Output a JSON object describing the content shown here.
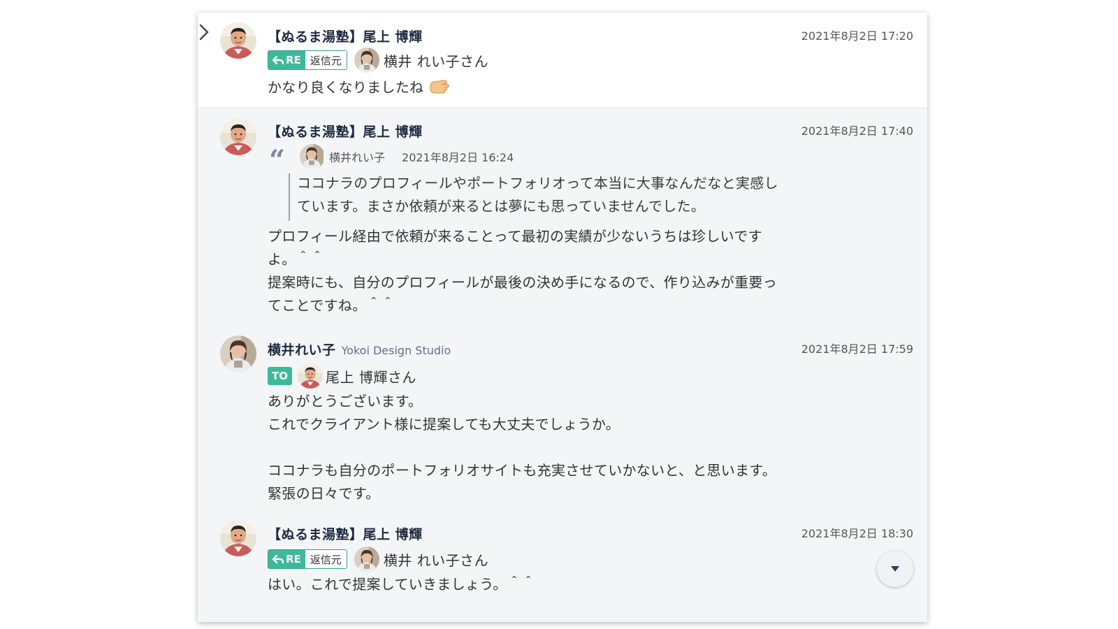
{
  "messages": [
    {
      "sender": "【ぬるま湯塾】尾上 博輝",
      "time": "2021年8月2日 17:20",
      "reply": {
        "badge": "RE",
        "source_label": "返信元",
        "target": "横井 れい子さん"
      },
      "body": [
        "かなり良くなりましたね"
      ]
    },
    {
      "sender": "【ぬるま湯塾】尾上 博輝",
      "time": "2021年8月2日 17:40",
      "quote": {
        "author": "横井れい子",
        "time": "2021年8月2日 16:24",
        "lines": [
          "ココナラのプロフィールやポートフォリオって本当に大事なんだなと実感し",
          "ています。まさか依頼が来るとは夢にも思っていませんでした。"
        ]
      },
      "body": [
        "プロフィール経由で依頼が来ることって最初の実績が少ないうちは珍しいです",
        "よ。＾＾",
        "提案時にも、自分のプロフィールが最後の決め手になるので、作り込みが重要っ",
        "てことですね。＾＾"
      ]
    },
    {
      "sender": "横井れい子",
      "org": "Yokoi Design Studio",
      "time": "2021年8月2日 17:59",
      "to": {
        "badge": "TO",
        "target": "尾上 博輝さん"
      },
      "body": [
        "ありがとうございます。",
        "これでクライアント様に提案しても大丈夫でしょうか。",
        "",
        "ココナラも自分のポートフォリオサイトも充実させていかないと、と思います。",
        "緊張の日々です。"
      ]
    },
    {
      "sender": "【ぬるま湯塾】尾上 博輝",
      "time": "2021年8月2日 18:30",
      "reply": {
        "badge": "RE",
        "source_label": "返信元",
        "target": "横井 れい子さん"
      },
      "body": [
        "はい。これで提案していきましょう。＾＾"
      ]
    }
  ],
  "icons": {
    "expand": "chevron-right-icon",
    "reply": "reply-arrow-icon",
    "quote": "quote-icon",
    "thumbs": "thumbs-up-emoji",
    "scroll": "caret-down-icon"
  },
  "colors": {
    "badge_green": "#3eb89b",
    "name_text": "#1c2a40",
    "org_text": "#5a7290"
  }
}
